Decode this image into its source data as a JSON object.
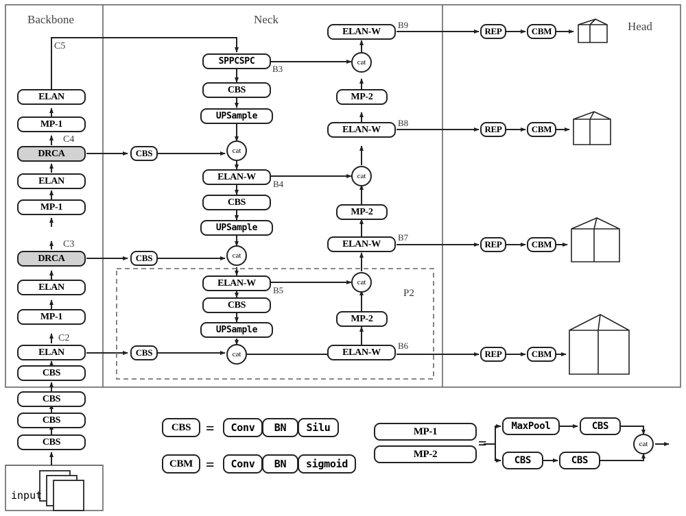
{
  "title": "Network architecture diagram",
  "sections": [
    {
      "name": "Backbone",
      "label": "Backbone"
    },
    {
      "name": "Neck",
      "label": "Neck"
    },
    {
      "name": "Head",
      "label": "Head"
    }
  ],
  "backbone": {
    "input_label": "input",
    "blocks": [
      {
        "label": "ELAN",
        "fill": "white",
        "tap": "C5"
      },
      {
        "label": "MP-1",
        "fill": "white",
        "tap": ""
      },
      {
        "label": "DRCA",
        "fill": "gray",
        "tap": "C4"
      },
      {
        "label": "ELAN",
        "fill": "white",
        "tap": ""
      },
      {
        "label": "MP-1",
        "fill": "white",
        "tap": ""
      },
      {
        "label": "DRCA",
        "fill": "gray",
        "tap": "C3"
      },
      {
        "label": "ELAN",
        "fill": "white",
        "tap": ""
      },
      {
        "label": "MP-1",
        "fill": "white",
        "tap": ""
      },
      {
        "label": "ELAN",
        "fill": "white",
        "tap": "C2"
      },
      {
        "label": "CBS",
        "fill": "white",
        "tap": ""
      },
      {
        "label": "CBS",
        "fill": "white",
        "tap": ""
      },
      {
        "label": "CBS",
        "fill": "white",
        "tap": ""
      },
      {
        "label": "CBS",
        "fill": "white",
        "tap": ""
      }
    ]
  },
  "neck": {
    "lateral_cbs": [
      "CBS",
      "CBS",
      "CBS"
    ],
    "topdown": [
      {
        "label": "SPPCSPC",
        "tag": "B3"
      },
      {
        "label": "CBS",
        "tag": ""
      },
      {
        "label": "UPSample",
        "tag": ""
      },
      {
        "label": "cat",
        "tag": ""
      },
      {
        "label": "ELAN-W",
        "tag": "B4"
      },
      {
        "label": "CBS",
        "tag": ""
      },
      {
        "label": "UPSample",
        "tag": ""
      },
      {
        "label": "cat",
        "tag": ""
      },
      {
        "label": "ELAN-W",
        "tag": "B5"
      },
      {
        "label": "CBS",
        "tag": ""
      },
      {
        "label": "UPSample",
        "tag": ""
      },
      {
        "label": "cat",
        "tag": ""
      }
    ],
    "bottomup": [
      {
        "label": "ELAN-W",
        "tag": "B6"
      },
      {
        "label": "MP-2",
        "tag": ""
      },
      {
        "label": "cat",
        "tag": ""
      },
      {
        "label": "ELAN-W",
        "tag": "B7"
      },
      {
        "label": "MP-2",
        "tag": ""
      },
      {
        "label": "cat",
        "tag": ""
      },
      {
        "label": "ELAN-W",
        "tag": "B8"
      },
      {
        "label": "MP-2",
        "tag": ""
      },
      {
        "label": "cat",
        "tag": ""
      },
      {
        "label": "ELAN-W",
        "tag": "B9"
      }
    ],
    "p2_label": "P2"
  },
  "head": {
    "branches": [
      {
        "rep": "REP",
        "cbm": "CBM",
        "output": "cube-small"
      },
      {
        "rep": "REP",
        "cbm": "CBM",
        "output": "cube-medium"
      },
      {
        "rep": "REP",
        "cbm": "CBM",
        "output": "cube-large"
      },
      {
        "rep": "REP",
        "cbm": "CBM",
        "output": "cube-xlarge"
      }
    ]
  },
  "legend": {
    "cbs": {
      "name": "CBS",
      "eq": "=",
      "parts": [
        "Conv",
        "BN",
        "Silu"
      ]
    },
    "cbm": {
      "name": "CBM",
      "eq": "=",
      "parts": [
        "Conv",
        "BN",
        "sigmoid"
      ]
    },
    "mp": {
      "names": [
        "MP-1",
        "MP-2"
      ],
      "eq": "=",
      "top_path": [
        "MaxPool",
        "CBS"
      ],
      "bottom_path": [
        "CBS",
        "CBS"
      ],
      "merge": "cat"
    }
  },
  "colors": {
    "stroke": "#222222",
    "frame": "#555555",
    "drca_fill": "#d2d2d2",
    "tap_label": "#444444",
    "dashed": "#777777"
  }
}
